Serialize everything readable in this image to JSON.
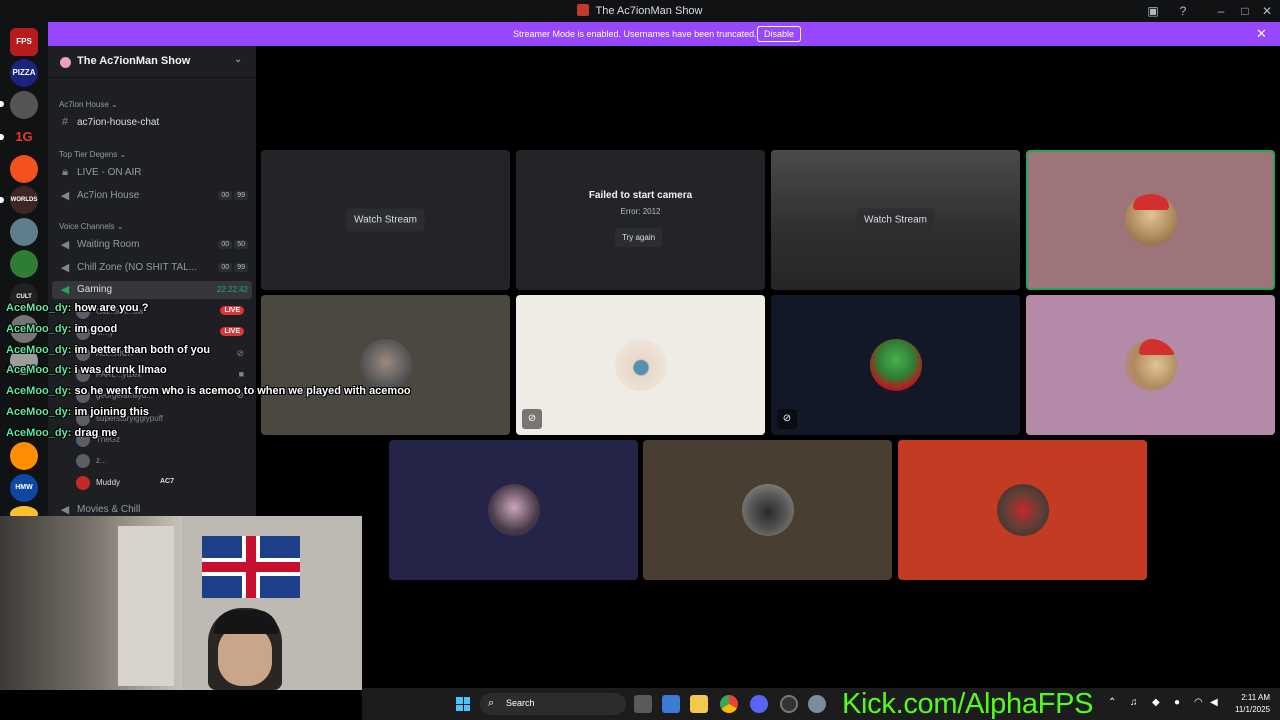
{
  "window": {
    "title": "The Ac7ionMan Show"
  },
  "banner": {
    "message": "Streamer Mode is enabled. Usernames have been truncated.",
    "disable_label": "Disable"
  },
  "server": {
    "name": "The Ac7ionMan Show"
  },
  "rail": {
    "icons": [
      "FPS",
      "PIZZA",
      "",
      "1G",
      "",
      "WORLDS",
      "",
      "",
      "CULT",
      "",
      "",
      "",
      "HMW",
      ""
    ]
  },
  "sidebar": {
    "categories": {
      "ac7ion_house": "Ac7ion House",
      "top_tier": "Top Tier Degens",
      "voice": "Voice Channels"
    },
    "channels": {
      "house_chat": "ac7ion-house-chat",
      "live_on_air": "LIVE - ON AIR",
      "ac7ion_house": "Ac7ion House",
      "waiting_room": "Waiting Room",
      "chill_zone": "Chill Zone (NO SHIT TAL...",
      "gaming": "Gaming",
      "movies": "Movies & Chill"
    },
    "counts": {
      "ac7ion_house": [
        "00",
        "99"
      ],
      "waiting_room": [
        "00",
        "50"
      ],
      "chill_zone": [
        "00",
        "99"
      ]
    },
    "gaming_timer": "22:22:42",
    "users": [
      {
        "name": "Gla...aiw...ow",
        "badge": "LIVE"
      },
      {
        "name": "m...y",
        "badge": "LIVE"
      },
      {
        "name": "Act...KICK",
        "badge": ""
      },
      {
        "name": "FARL ..ytzex",
        "badge": ""
      },
      {
        "name": "georgefamilyd...",
        "badge": ""
      },
      {
        "name": "superstaryigglypuff",
        "badge": ""
      },
      {
        "name": "TheGz",
        "badge": ""
      },
      {
        "name": "z...",
        "badge": ""
      },
      {
        "name": "Muddy",
        "badge": "AC7"
      }
    ]
  },
  "tiles": {
    "watch_stream": "Watch Stream",
    "fail_title": "Failed to start camera",
    "fail_code": "Error: 2012",
    "try_again": "Try again"
  },
  "chat": [
    {
      "user": "AceMoo_dy:",
      "text": "how are you ?"
    },
    {
      "user": "AceMoo_dy:",
      "text": "im good"
    },
    {
      "user": "AceMoo_dy:",
      "text": "im better than both of you"
    },
    {
      "user": "AceMoo_dy:",
      "text": "i was drunk llmao"
    },
    {
      "user": "AceMoo_dy:",
      "text": "so he went from who is acemoo to when we played with acemoo"
    },
    {
      "user": "AceMoo_dy:",
      "text": "im joining this"
    },
    {
      "user": "AceMoo_dy:",
      "text": "drag me"
    }
  ],
  "taskbar": {
    "search_placeholder": "Search",
    "kick_url": "Kick.com/AlphaFPS",
    "time": "2:11 AM",
    "date": "11/1/2025"
  },
  "colors": {
    "banner": "#9747ff",
    "sidebar": "#1e1f22",
    "kick_green": "#53fc18",
    "live_red": "#da373c",
    "speaking_border": "#23a55a"
  }
}
